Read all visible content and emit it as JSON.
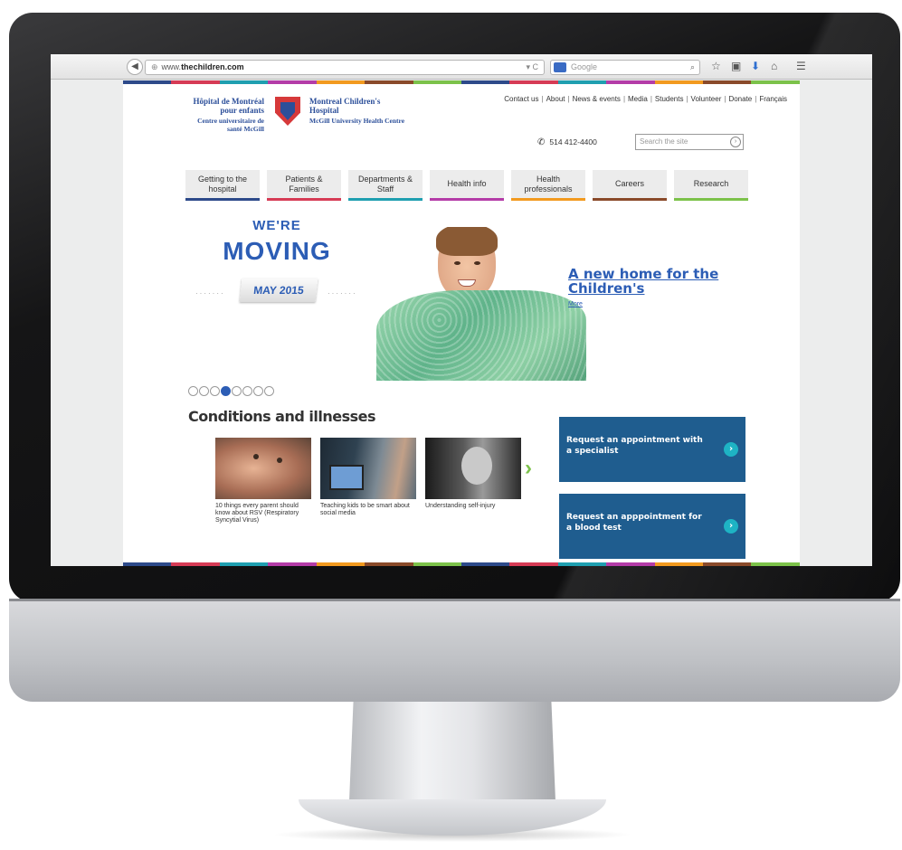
{
  "browser": {
    "url_prefix": "www.",
    "url_host": "thechildren.com",
    "search_placeholder": "Google"
  },
  "brand": {
    "fr_name": "Hôpital de Montréal pour enfants",
    "fr_sub": "Centre universitaire de santé McGill",
    "en_name": "Montreal Children's Hospital",
    "en_sub": "McGill University Health Centre"
  },
  "top_links": [
    "Contact us",
    "About",
    "News & events",
    "Media",
    "Students",
    "Volunteer",
    "Donate",
    "Français"
  ],
  "phone": "514 412-4400",
  "site_search_placeholder": "Search the site",
  "nav": [
    {
      "label": "Getting to the hospital",
      "color": "#2d4a8a"
    },
    {
      "label": "Patients & Families",
      "color": "#d63b55"
    },
    {
      "label": "Departments & Staff",
      "color": "#1f9fb0"
    },
    {
      "label": "Health info",
      "color": "#b43ca8"
    },
    {
      "label": "Health professionals",
      "color": "#f29a1f"
    },
    {
      "label": "Careers",
      "color": "#8a4a2a"
    },
    {
      "label": "Research",
      "color": "#7cc24a"
    }
  ],
  "hero": {
    "were": "WE'RE",
    "moving": "MOVING",
    "date": "MAY 2015",
    "link": "A new home for the Children's",
    "more": "More",
    "slides": 8,
    "active_slide": 4
  },
  "conditions": {
    "title": "Conditions and illnesses",
    "cards": [
      {
        "caption": "10 things every parent should know about RSV (Respiratory Syncytial Virus)"
      },
      {
        "caption": "Teaching kids to be smart about social media"
      },
      {
        "caption": "Understanding self-injury"
      }
    ]
  },
  "cta": [
    {
      "label": "Request an appointment with a specialist"
    },
    {
      "label": "Request an apppointment for a blood test"
    }
  ],
  "colors": {
    "brand_blue": "#2c5db5",
    "cta_blue": "#1f5d8f",
    "stripe": [
      "#2d4a8a",
      "#d63b55",
      "#1f9fb0",
      "#b43ca8",
      "#f29a1f",
      "#8a4a2a",
      "#7cc24a",
      "#2d4a8a",
      "#d63b55",
      "#1f9fb0",
      "#b43ca8",
      "#f29a1f",
      "#8a4a2a",
      "#7cc24a"
    ]
  }
}
